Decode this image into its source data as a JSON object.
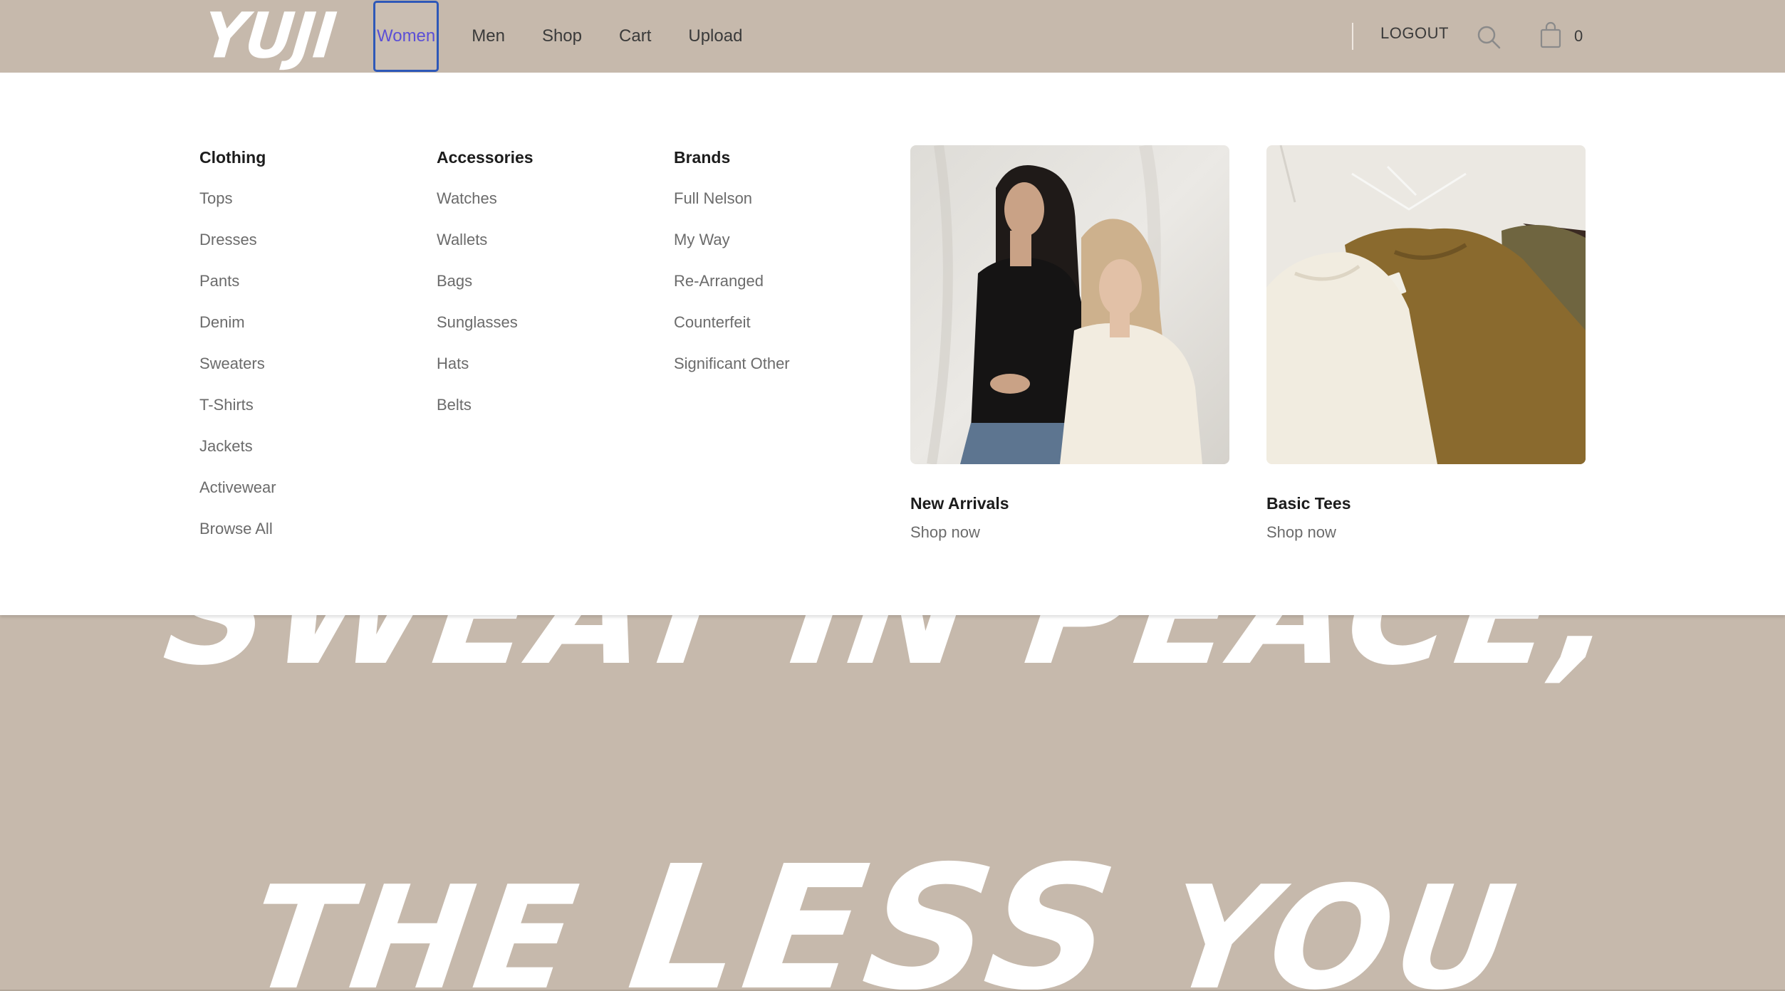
{
  "brand": {
    "logo_text": "YUJI"
  },
  "nav": {
    "items": [
      {
        "label": "Women",
        "active": true
      },
      {
        "label": "Men"
      },
      {
        "label": "Shop"
      },
      {
        "label": "Cart"
      },
      {
        "label": "Upload"
      }
    ]
  },
  "header": {
    "logout_label": "LOGOUT",
    "search_icon": "search-icon",
    "bag_icon": "shopping-bag-icon",
    "cart_count": "0"
  },
  "dropdown": {
    "columns": [
      {
        "heading": "Clothing",
        "items": [
          "Tops",
          "Dresses",
          "Pants",
          "Denim",
          "Sweaters",
          "T-Shirts",
          "Jackets",
          "Activewear",
          "Browse All"
        ]
      },
      {
        "heading": "Accessories",
        "items": [
          "Watches",
          "Wallets",
          "Bags",
          "Sunglasses",
          "Hats",
          "Belts"
        ]
      },
      {
        "heading": "Brands",
        "items": [
          "Full Nelson",
          "My Way",
          "Re-Arranged",
          "Counterfeit",
          "Significant Other"
        ]
      }
    ],
    "features": [
      {
        "title": "New Arrivals",
        "cta": "Shop now"
      },
      {
        "title": "Basic Tees",
        "cta": "Shop now"
      }
    ]
  },
  "hero": {
    "line1": "SWEAT IN PEACE,",
    "line2_a": "THE ",
    "line2_b": "LESS",
    "line2_c": " YOU"
  },
  "colors": {
    "header_bg": "#c6b9ac",
    "panel_bg": "#ffffff",
    "active_nav": "#5b4fd6",
    "focus_ring": "#2e58b8"
  }
}
